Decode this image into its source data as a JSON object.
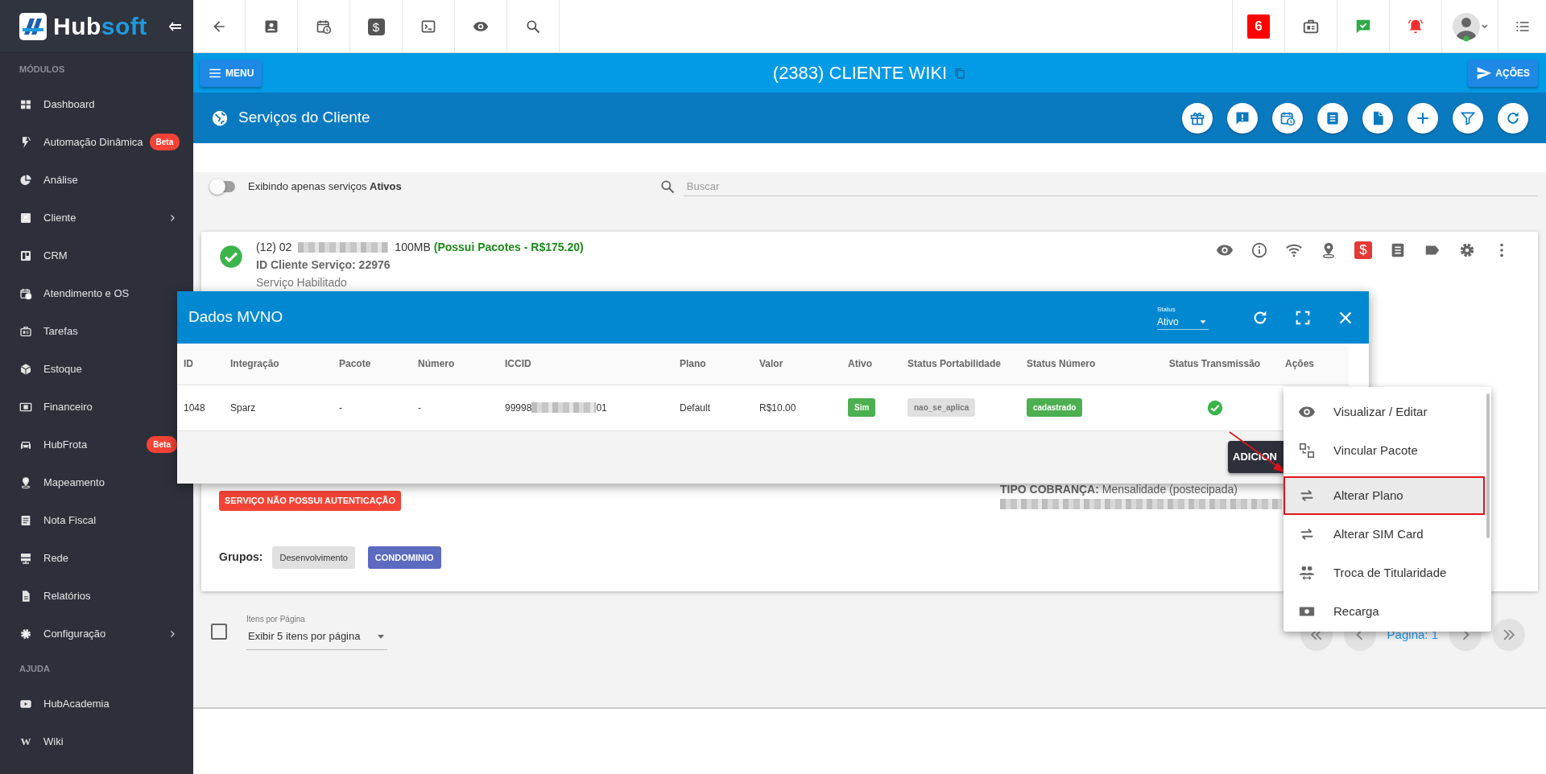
{
  "sidebar": {
    "logo": {
      "part1": "Hub",
      "part2": "soft"
    },
    "sections": [
      {
        "title": "MÓDULOS",
        "items": [
          {
            "label": "Dashboard",
            "expandable": false
          },
          {
            "label": "Automação Dinâmica",
            "badge": "Beta",
            "expandable": false
          },
          {
            "label": "Análise",
            "expandable": false
          },
          {
            "label": "Cliente",
            "expandable": true
          },
          {
            "label": "CRM",
            "expandable": false
          },
          {
            "label": "Atendimento e OS",
            "expandable": false
          },
          {
            "label": "Tarefas",
            "expandable": false
          },
          {
            "label": "Estoque",
            "expandable": false
          },
          {
            "label": "Financeiro",
            "expandable": false
          },
          {
            "label": "HubFrota",
            "badge": "Beta",
            "expandable": false
          },
          {
            "label": "Mapeamento",
            "expandable": false
          },
          {
            "label": "Nota Fiscal",
            "expandable": false
          },
          {
            "label": "Rede",
            "expandable": false
          },
          {
            "label": "Relatórios",
            "expandable": false
          },
          {
            "label": "Configuração",
            "expandable": true
          }
        ]
      },
      {
        "title": "AJUDA",
        "items": [
          {
            "label": "HubAcademia",
            "expandable": false
          },
          {
            "label": "Wiki",
            "icon_glyph": "W",
            "expandable": false
          }
        ]
      }
    ]
  },
  "top_toolbar": {
    "billing_glyph": "$",
    "notification_count": "6"
  },
  "client_bar": {
    "menu_button": "MENU",
    "title": "(2383) CLIENTE WIKI",
    "actions_button": "AÇÕES"
  },
  "section": {
    "title": "Serviços do Cliente"
  },
  "filter": {
    "toggle_label": "Exibindo apenas serviços **Ativos**",
    "toggle_on": false,
    "search_placeholder": "Buscar"
  },
  "service": {
    "status_ok": true,
    "number_prefix": "(12) 02",
    "plan": "100MB",
    "packages": "(Possui Pacotes - R$175.20)",
    "client_service_id": "ID Cliente Serviço: 22976",
    "state": "Serviço Habilitado",
    "billing_glyph": "$",
    "billing_type": "**TIPO COBRANÇA:** Mensalidade (postecipada)",
    "auth_badge": "SERVIÇO NÃO POSSUI AUTENTICAÇÃO",
    "groups_label": "Grupos:",
    "groups": [
      {
        "label": "Desenvolvimento",
        "color": "#e0e0e0"
      },
      {
        "label": "CONDOMINIO",
        "color": "#5c6bc0"
      }
    ]
  },
  "list_footer": {
    "select_all_checked": false,
    "per_page_label": "Itens por Página",
    "per_page_value": "Exibir 5 itens por página",
    "page_label": "Página: 1"
  },
  "modal": {
    "title": "Dados MVNO",
    "status_label": "Status",
    "status_value": "Ativo",
    "columns": [
      "ID",
      "Integração",
      "Pacote",
      "Número",
      "ICCID",
      "Plano",
      "Valor",
      "Ativo",
      "Status Portabilidade",
      "Status Número",
      "Status Transmissão",
      "Ações"
    ],
    "rows": [
      {
        "id": "1048",
        "integration": "Sparz",
        "package": "-",
        "number": "-",
        "iccid_start": "99998",
        "iccid_end": "01",
        "plan": "Default",
        "value": "R$10.00",
        "active": {
          "text": "Sim",
          "color": "#4caf50"
        },
        "portability": {
          "text": "nao_se_aplica",
          "color": "#e0e0e0"
        },
        "number_status": {
          "text": "cadastrado",
          "color": "#4caf50"
        },
        "transmission_ok": true
      }
    ],
    "add_button": "ADICION"
  },
  "actions_menu": {
    "items": [
      {
        "label": "Visualizar / Editar",
        "selected": false
      },
      {
        "label": "Vincular Pacote",
        "selected": false
      },
      {
        "label": "Alterar Plano",
        "selected": true
      },
      {
        "label": "Alterar SIM Card",
        "selected": false
      },
      {
        "label": "Troca de Titularidade",
        "selected": false
      },
      {
        "label": "Recarga",
        "selected": false
      }
    ]
  }
}
